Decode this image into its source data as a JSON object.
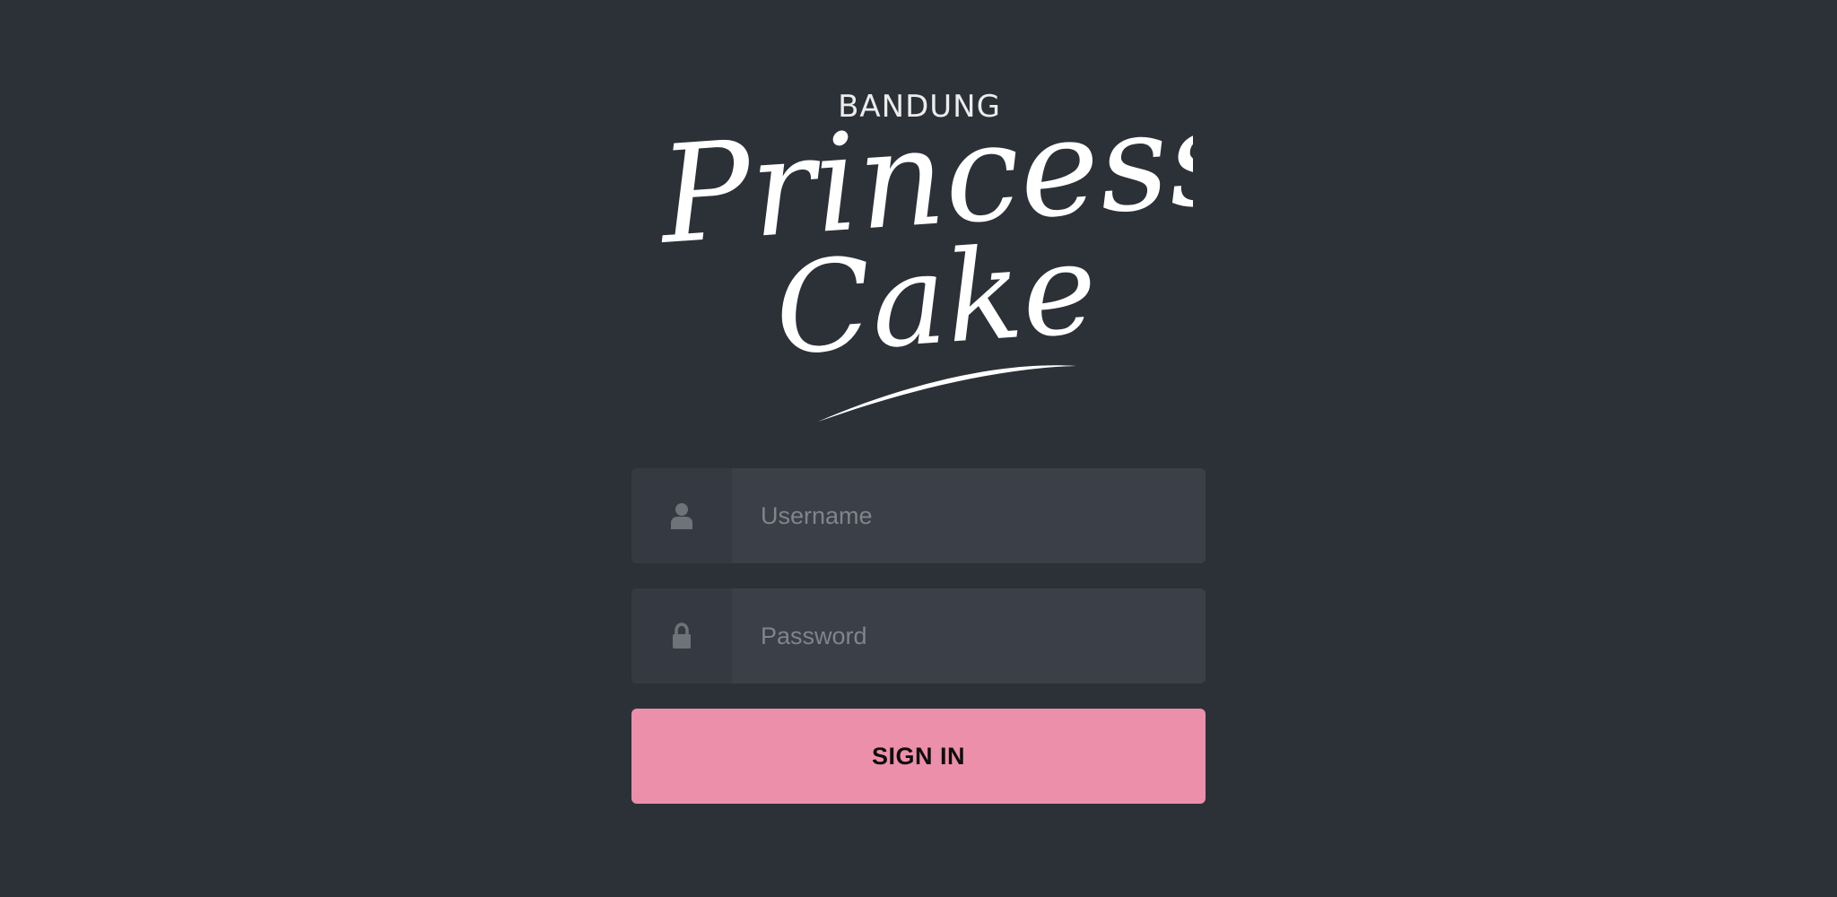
{
  "logo": {
    "top_text": "BANDUNG",
    "line1": "Princess",
    "line2": "Cake"
  },
  "login": {
    "username": {
      "placeholder": "Username",
      "value": "",
      "icon": "user-icon"
    },
    "password": {
      "placeholder": "Password",
      "value": "",
      "icon": "lock-icon"
    },
    "submit_label": "SIGN IN"
  },
  "colors": {
    "background": "#2c3138",
    "field_background": "#3a3f48",
    "icon_cell_background": "#353a42",
    "button": "#ec8fab",
    "icon": "#6e737a"
  }
}
